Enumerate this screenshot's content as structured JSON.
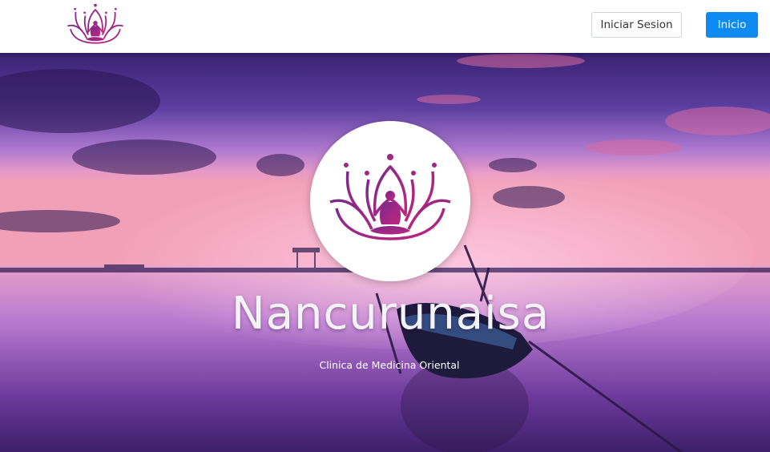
{
  "navbar": {
    "logo_icon": "lotus-meditation-logo",
    "login_label": "Iniciar Sesion",
    "home_label": "Inicio"
  },
  "hero": {
    "logo_icon": "lotus-meditation-logo",
    "title": "Nancurunaisa",
    "subtitle": "Clinica de Medicina Oriental",
    "background": "sunset-lake-with-boat"
  },
  "colors": {
    "primary_button": "#0d8bf2",
    "logo_purple": "#7b2a8c",
    "logo_magenta": "#c0267d",
    "sky_top": "#3a1f7a",
    "sky_pink": "#f08ab8",
    "water": "#6d3a9c"
  }
}
